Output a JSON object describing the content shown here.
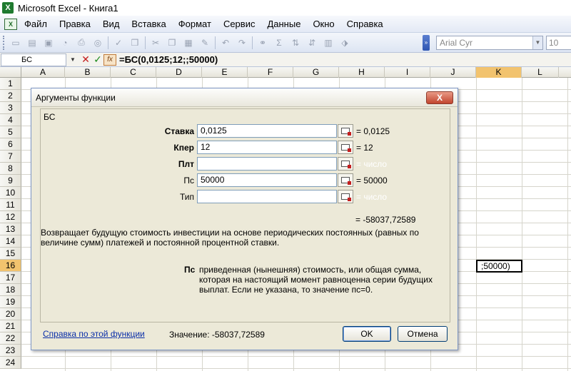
{
  "app": {
    "title": "Microsoft Excel - Книга1"
  },
  "menu": {
    "items": [
      "Файл",
      "Правка",
      "Вид",
      "Вставка",
      "Формат",
      "Сервис",
      "Данные",
      "Окно",
      "Справка"
    ]
  },
  "toolbar": {
    "font_name": "Arial Cyr",
    "font_size": "10"
  },
  "formula_bar": {
    "name_box": "БС",
    "formula": "=БС(0,0125;12;;50000)"
  },
  "grid": {
    "columns": [
      "A",
      "B",
      "C",
      "D",
      "E",
      "F",
      "G",
      "H",
      "I",
      "J",
      "K",
      "L"
    ],
    "rows": [
      "1",
      "2",
      "3",
      "4",
      "5",
      "6",
      "7",
      "8",
      "9",
      "10",
      "11",
      "12",
      "13",
      "14",
      "15",
      "16",
      "17",
      "18",
      "19",
      "20",
      "21",
      "22",
      "23",
      "24"
    ],
    "active_column": "K",
    "active_row": "16",
    "active_cell_text": ";50000)"
  },
  "dialog": {
    "title": "Аргументы функции",
    "close_label": "X",
    "function_name": "БС",
    "args": [
      {
        "label": "Ставка",
        "value": "0,0125",
        "result": "= 0,0125",
        "bold": true
      },
      {
        "label": "Кпер",
        "value": "12",
        "result": "= 12",
        "bold": true
      },
      {
        "label": "Плт",
        "value": "",
        "result": "= число",
        "bold": true
      },
      {
        "label": "Пс",
        "value": "50000",
        "result": "= 50000",
        "bold": false
      },
      {
        "label": "Тип",
        "value": "",
        "result": "= число",
        "bold": false
      }
    ],
    "formula_result": "= -58037,72589",
    "description": "Возвращает будущую стоимость инвестиции на основе периодических постоянных (равных по величине сумм) платежей и постоянной процентной ставки.",
    "param_name": "Пс",
    "param_description": "приведенная (нынешняя) стоимость, или общая сумма, которая на настоящий момент равноценна серии будущих выплат. Если не указана, то значение пс=0.",
    "help_link": "Справка по этой функции",
    "value_line": "Значение: -58037,72589",
    "ok_label": "OK",
    "cancel_label": "Отмена"
  }
}
